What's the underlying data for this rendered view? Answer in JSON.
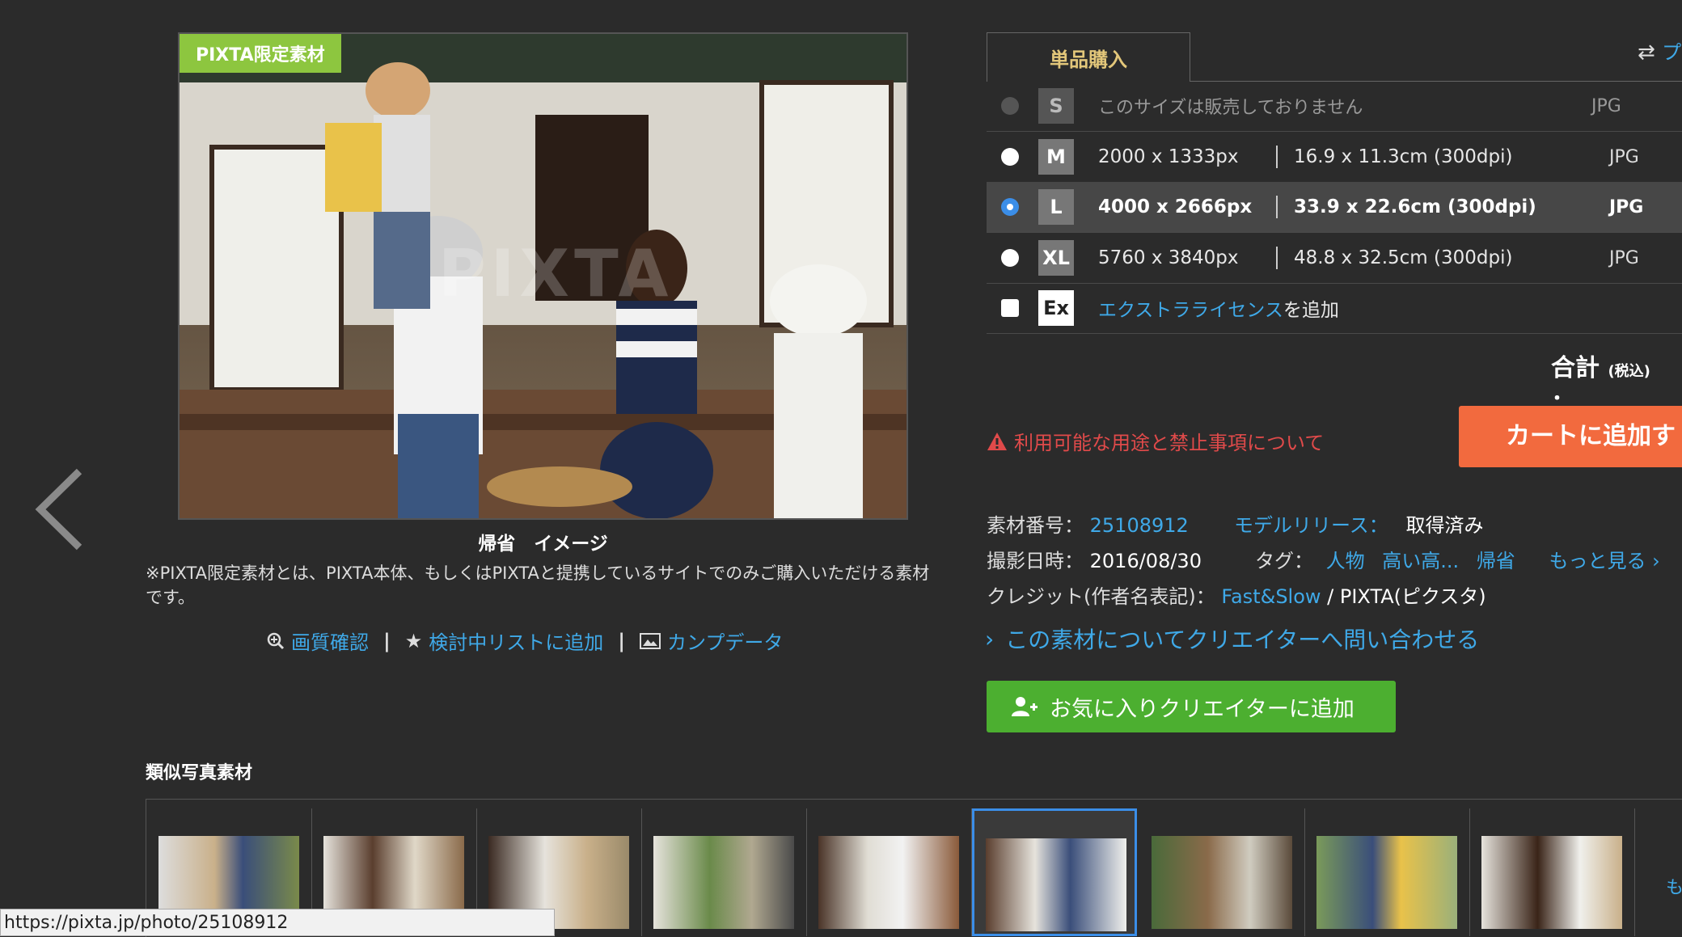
{
  "photo": {
    "badge": "PIXTA限定素材",
    "caption": "帰省　イメージ",
    "watermark": "PIXTA",
    "note": "※PIXTA限定素材とは、PIXTA本体、もしくはPIXTAと提携しているサイトでのみご購入いただける素材です。"
  },
  "tools": {
    "zoom": "画質確認",
    "wishlist": "検討中リストに追加",
    "comp": "カンプデータ"
  },
  "purchase": {
    "tab": "単品購入",
    "swap_text": "プ",
    "options": [
      {
        "code": "S",
        "unavailable": "このサイズは販売しておりません",
        "format": "JPG"
      },
      {
        "code": "M",
        "px": "2000 x 1333px",
        "cm": "16.9 x 11.3cm (300dpi)",
        "format": "JPG"
      },
      {
        "code": "L",
        "px": "4000 x 2666px",
        "cm": "33.9 x 22.6cm (300dpi)",
        "format": "JPG"
      },
      {
        "code": "XL",
        "px": "5760 x 3840px",
        "cm": "48.8 x 32.5cm (300dpi)",
        "format": "JPG"
      }
    ],
    "extra": {
      "code": "Ex",
      "link": "エクストラライセンス",
      "suffix": "を追加"
    },
    "total_label": "合計",
    "total_tax": "(税込)",
    "total_colon": "：",
    "warning": "利用可能な用途と禁止事項について",
    "cart_button": "カートに追加す"
  },
  "info": {
    "id_label": "素材番号：",
    "id_value": "25108912",
    "model_label": "モデルリリース：",
    "model_value": "取得済み",
    "date_label": "撮影日時：",
    "date_value": "2016/08/30",
    "tag_label": "タグ：",
    "tags": [
      "人物",
      "高い高...",
      "帰省"
    ],
    "more": "もっと見る",
    "credit_label": "クレジット(作者名表記)：",
    "credit_author": "Fast&Slow",
    "credit_sep": " / ",
    "credit_site": "PIXTA(ピクスタ)"
  },
  "contact_link": "この素材についてクリエイターへ問い合わせる",
  "fav_button": "お気に入りクリエイターに追加",
  "similar": {
    "title": "類似写真素材",
    "more": "も"
  },
  "status_url": "https://pixta.jp/photo/25108912",
  "colors": {
    "accent_blue": "#3fa9e8",
    "cart": "#f26a3e",
    "fav": "#4caf30",
    "badge": "#8dc63f",
    "warning": "#e04a4a"
  }
}
